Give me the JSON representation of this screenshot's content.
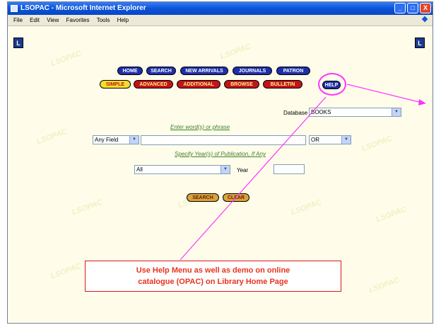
{
  "window": {
    "title": "LSOPAC - Microsoft Internet Explorer",
    "buttons": {
      "minimize": "_",
      "maximize": "□",
      "close": "X"
    }
  },
  "menubar": {
    "items": [
      "File",
      "Edit",
      "View",
      "Favorites",
      "Tools",
      "Help"
    ]
  },
  "logo_text": "L",
  "nav_row1": [
    "HOME",
    "SEARCH",
    "NEW ARRIVALS",
    "JOURNALS",
    "PATRON"
  ],
  "nav_row2": [
    "SIMPLE",
    "ADVANCED",
    "ADDITIONAL",
    "BROWSE",
    "BULLETIN",
    "HELP"
  ],
  "search": {
    "database_label": "Database",
    "database_value": "BOOKS",
    "prompt": "Enter word(s) or phrase",
    "field_select": "Any Field",
    "operator_select": "OR",
    "year_prompt": "Specify Year(s) of Publication, If Any",
    "year_select": "All",
    "year_label": "Year"
  },
  "actions": {
    "search": "SEARCH",
    "clear": "CLEAR"
  },
  "callout": {
    "line1": "Use Help Menu as well as demo on online",
    "line2": "catalogue (OPAC)  on Library Home Page"
  },
  "colors": {
    "annotation": "#ff33ff",
    "callout_text": "#e8341c",
    "background": "#fffdea"
  }
}
